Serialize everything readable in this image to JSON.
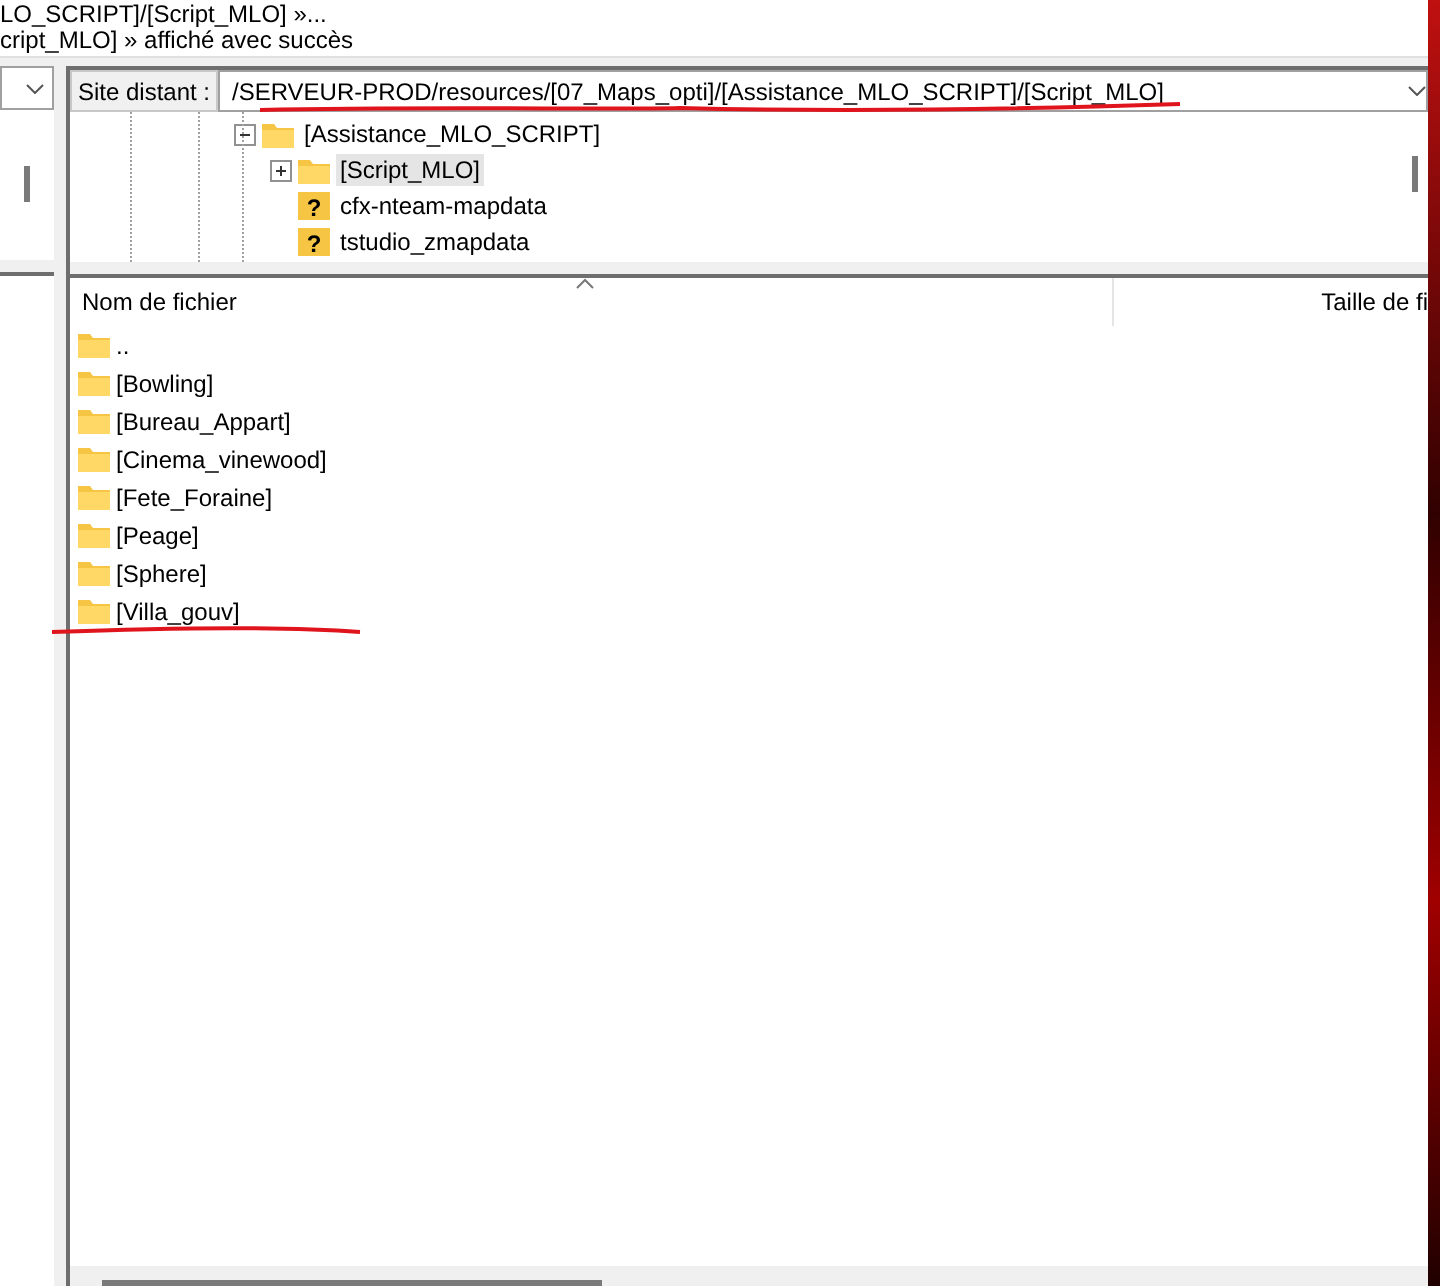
{
  "log": {
    "lines": [
      "LO_SCRIPT]/[Script_MLO] »...",
      "cript_MLO] » affiché avec succès"
    ]
  },
  "remote_site": {
    "label": "Site distant :",
    "path": "/SERVEUR-PROD/resources/[07_Maps_opti]/[Assistance_MLO_SCRIPT]/[Script_MLO]"
  },
  "tree": [
    {
      "label": "[Assistance_MLO_SCRIPT]",
      "kind": "folder",
      "expanded": true,
      "selected": false,
      "children": [
        {
          "label": "[Script_MLO]",
          "kind": "folder",
          "expanded": false,
          "selected": true
        },
        {
          "label": "cfx-nteam-mapdata",
          "kind": "unknown",
          "icon_glyph": "?",
          "selected": false
        },
        {
          "label": "tstudio_zmapdata",
          "kind": "unknown",
          "icon_glyph": "?",
          "selected": false
        }
      ]
    }
  ],
  "file_list": {
    "columns": [
      "Nom de fichier",
      "Taille de fi"
    ],
    "rows": [
      {
        "name": ".."
      },
      {
        "name": "[Bowling]"
      },
      {
        "name": "[Bureau_Appart]"
      },
      {
        "name": "[Cinema_vinewood]"
      },
      {
        "name": "[Fete_Foraine]"
      },
      {
        "name": "[Peage]"
      },
      {
        "name": "[Sphere]"
      },
      {
        "name": "[Villa_gouv]"
      }
    ]
  }
}
